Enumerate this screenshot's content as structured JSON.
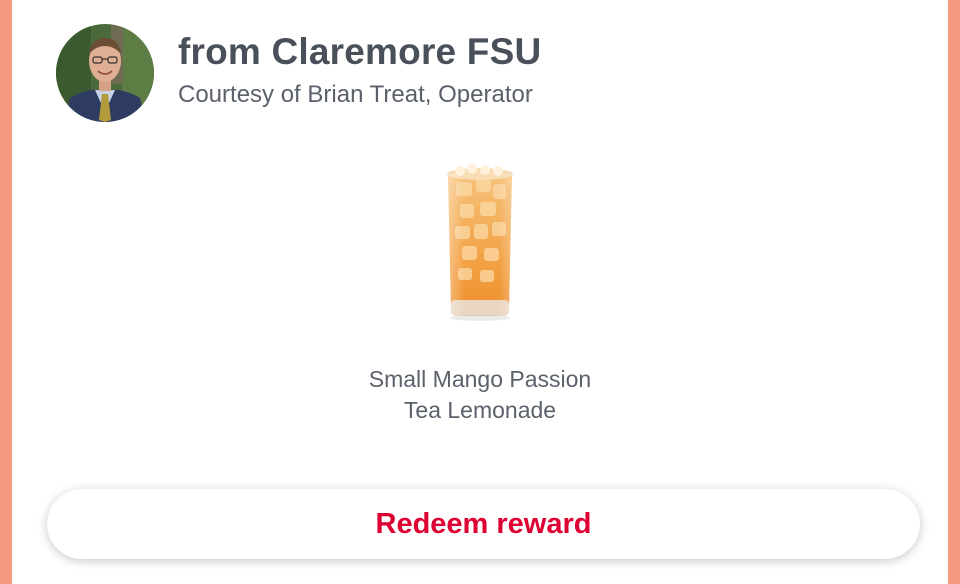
{
  "header": {
    "title": "from Claremore FSU",
    "subtitle": "Courtesy of Brian Treat, Operator"
  },
  "reward": {
    "image_icon": "iced-tea-glass-image",
    "name_line1": "Small Mango Passion",
    "name_line2": "Tea Lemonade"
  },
  "actions": {
    "redeem_label": "Redeem reward"
  },
  "colors": {
    "background_accent": "#f59a7f",
    "card": "#ffffff",
    "title_text": "#4a505a",
    "body_text": "#5b616b",
    "brand_red": "#dd0033",
    "drink_orange": "#f0a243"
  }
}
